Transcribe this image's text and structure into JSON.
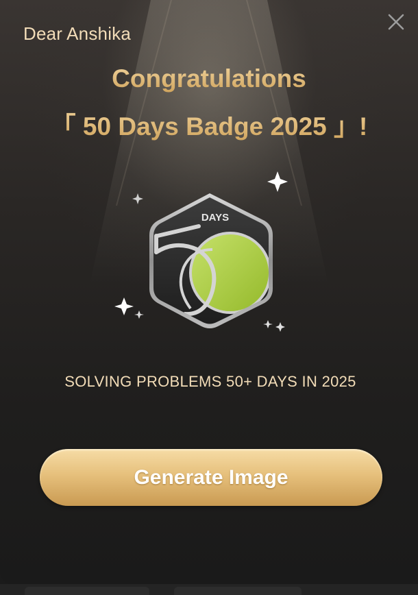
{
  "greeting": "Dear Anshika",
  "title_line1": "Congratulations",
  "title_line2": "「 50 Days Badge 2025 」!",
  "badge": {
    "label": "DAYS",
    "accent_color": "#a6c93a"
  },
  "subtitle": "SOLVING PROBLEMS 50+ DAYS IN 2025",
  "cta_label": "Generate Image",
  "icons": {
    "close": "close-icon",
    "sparkle": "sparkle-icon"
  },
  "colors": {
    "gold_text": "#e2bd7a",
    "cream_text": "#f2dcb8",
    "button_gold": "#e6c07c"
  }
}
